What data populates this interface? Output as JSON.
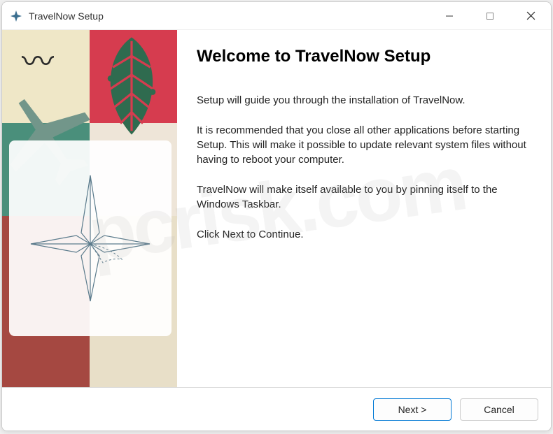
{
  "window": {
    "title": "TravelNow Setup"
  },
  "header": {
    "heading": "Welcome to TravelNow Setup"
  },
  "paragraphs": {
    "p1": "Setup will guide you through the installation of TravelNow.",
    "p2": "It is recommended that you close all other applications before starting Setup.  This will make it possible to update relevant system files without having to reboot your computer.",
    "p3": "TravelNow will make itself available to you by pinning itself to the Windows Taskbar.",
    "p4": "Click Next to Continue."
  },
  "buttons": {
    "next": "Next >",
    "cancel": "Cancel"
  },
  "watermark": "pcrisk.com"
}
